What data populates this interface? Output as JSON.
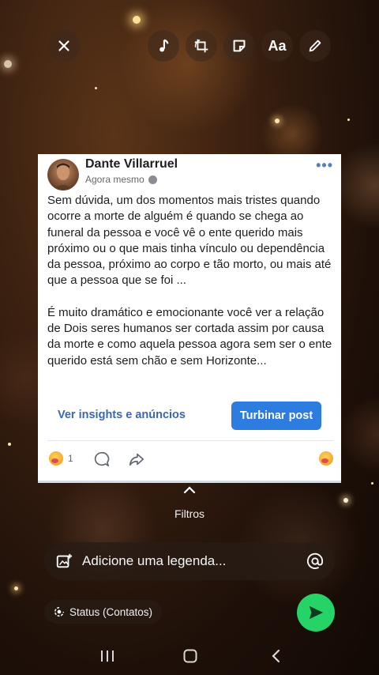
{
  "top_bar": {
    "close_icon": "close-icon",
    "music_icon": "music-note-icon",
    "crop_rotate_icon": "crop-rotate-icon",
    "sticker_icon": "sticker-icon",
    "text_label": "Aa",
    "draw_icon": "pencil-icon"
  },
  "post": {
    "author": "Dante Villarruel",
    "time": "Agora mesmo",
    "paragraphs": [
      "Sem dúvida, um dos momentos mais tristes quando ocorre a morte de alguém é quando se chega ao funeral da pessoa e você vê o ente querido mais próximo ou o que mais tinha vínculo ou dependência da pessoa,  próximo ao corpo e tão morto, ou mais até que a pessoa que se foi ...",
      "É muito dramático e emocionante você ver a relação de Dois seres humanos ser cortada assim por causa da morte e como aquela pessoa agora sem ser o ente querido está sem chão e sem Horizonte..."
    ],
    "insights_label": "Ver insights e anúncios",
    "boost_label": "Turbinar post",
    "reaction_count": "1"
  },
  "filters_label": "Filtros",
  "caption": {
    "placeholder": "Adicione uma legenda..."
  },
  "status_label": "Status (Contatos)",
  "colors": {
    "send": "#25d366",
    "boost": "#2d7de0",
    "link": "#3c67b0"
  }
}
